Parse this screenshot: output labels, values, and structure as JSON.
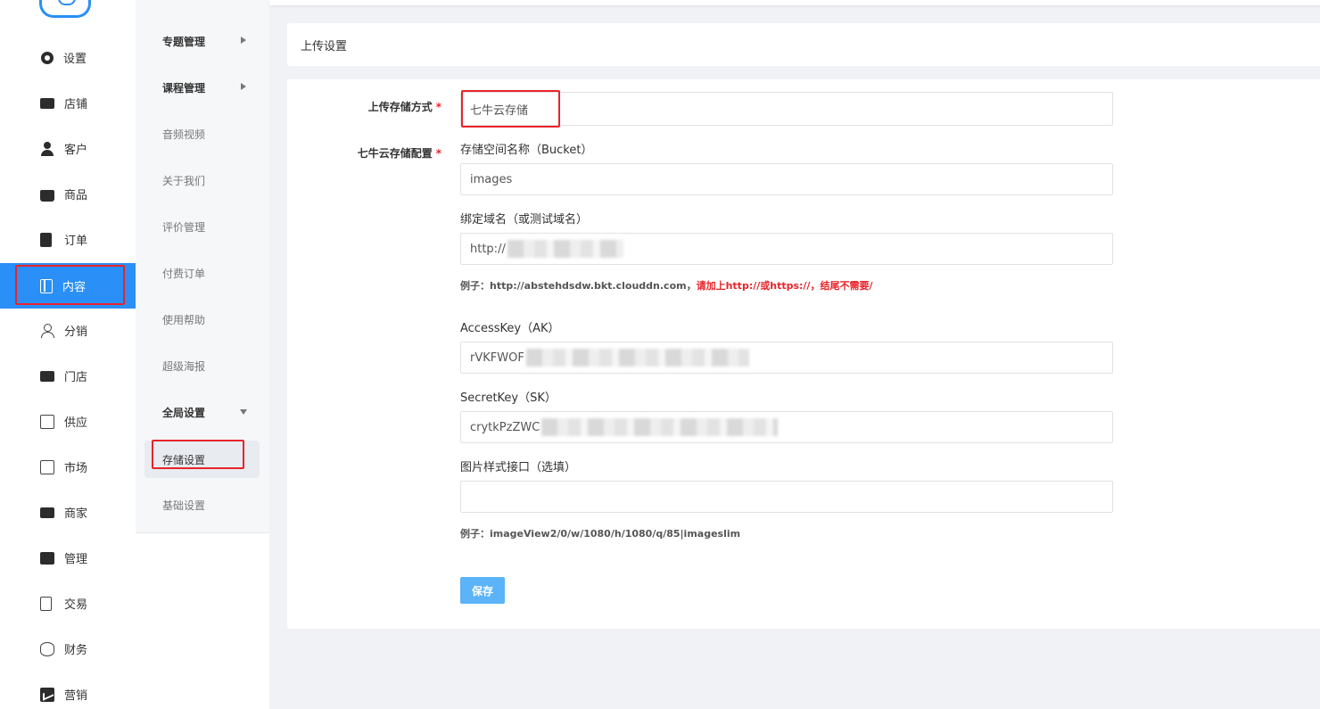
{
  "sidebar": {
    "items": [
      {
        "label": "设置",
        "icon": "gear-icon"
      },
      {
        "label": "店铺",
        "icon": "shop-icon"
      },
      {
        "label": "客户",
        "icon": "user-icon"
      },
      {
        "label": "商品",
        "icon": "bag-icon"
      },
      {
        "label": "订单",
        "icon": "clipboard-icon"
      },
      {
        "label": "内容",
        "icon": "book-icon"
      },
      {
        "label": "分销",
        "icon": "user-outline-icon"
      },
      {
        "label": "门店",
        "icon": "store-icon"
      },
      {
        "label": "供应",
        "icon": "building-icon"
      },
      {
        "label": "市场",
        "icon": "building-icon"
      },
      {
        "label": "商家",
        "icon": "merchant-icon"
      },
      {
        "label": "管理",
        "icon": "manage-icon"
      },
      {
        "label": "交易",
        "icon": "document-icon"
      },
      {
        "label": "财务",
        "icon": "database-icon"
      },
      {
        "label": "营销",
        "icon": "chart-icon"
      }
    ],
    "active_index": 5,
    "active_color": "#2a8ff7"
  },
  "subnav": {
    "items": [
      {
        "label": "专题管理"
      },
      {
        "label": "课程管理"
      },
      {
        "label": "音频视频"
      },
      {
        "label": "关于我们"
      },
      {
        "label": "评价管理"
      },
      {
        "label": "付费订单"
      },
      {
        "label": "使用帮助"
      },
      {
        "label": "超级海报"
      },
      {
        "label": "全局设置"
      },
      {
        "label": "存储设置"
      },
      {
        "label": "基础设置"
      }
    ]
  },
  "page": {
    "title": "上传设置"
  },
  "form": {
    "storage_method_label": "上传存储方式",
    "storage_method_value": "七牛云存储",
    "qiniu_config_label": "七牛云存储配置",
    "required_mark": "*",
    "bucket_label": "存储空间名称（Bucket）",
    "bucket_value": "images",
    "domain_label": "绑定域名（或测试域名）",
    "domain_value": "http://",
    "domain_hint_prefix": "例子：http://abstehdsdw.bkt.clouddn.com，",
    "domain_hint_warn": "请加上http://或https://，结尾不需要/",
    "ak_label": "AccessKey（AK）",
    "ak_value": "rVKFWOF",
    "sk_label": "SecretKey（SK）",
    "sk_value": "crytkPzZWC",
    "style_label": "图片样式接口（选填）",
    "style_value": "",
    "style_hint": "例子：imageView2/0/w/1080/h/1080/q/85|imageslim",
    "save_label": "保存"
  },
  "colors": {
    "primary": "#2a8ff7",
    "button": "#5cb3f7",
    "highlight_box": "#e8242b"
  }
}
